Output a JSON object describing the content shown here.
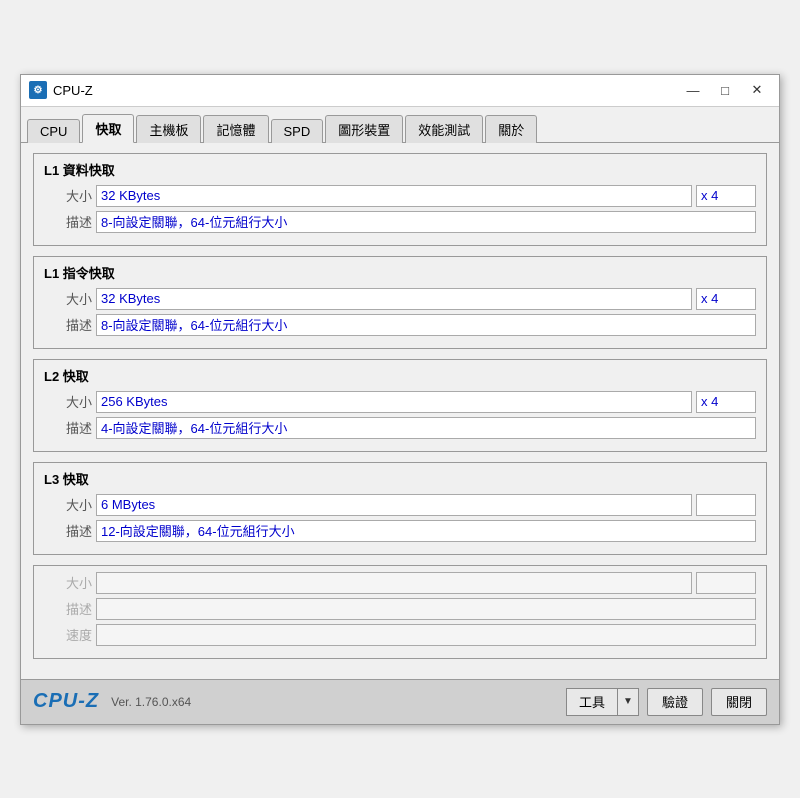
{
  "window": {
    "title": "CPU-Z",
    "icon_label": "⚙"
  },
  "title_controls": {
    "minimize": "—",
    "maximize": "□",
    "close": "✕"
  },
  "tabs": [
    {
      "id": "cpu",
      "label": "CPU",
      "active": false
    },
    {
      "id": "cache",
      "label": "快取",
      "active": true
    },
    {
      "id": "mainboard",
      "label": "主機板",
      "active": false
    },
    {
      "id": "memory",
      "label": "記憶體",
      "active": false
    },
    {
      "id": "spd",
      "label": "SPD",
      "active": false
    },
    {
      "id": "graphics",
      "label": "圖形裝置",
      "active": false
    },
    {
      "id": "benchmark",
      "label": "效能測試",
      "active": false
    },
    {
      "id": "about",
      "label": "關於",
      "active": false
    }
  ],
  "cache_sections": [
    {
      "id": "l1-data",
      "title": "L1 資料快取",
      "enabled": true,
      "size_value": "32 KBytes",
      "multiplier": "x 4",
      "desc_value": "8-向設定關聯，64-位元組行大小"
    },
    {
      "id": "l1-instruction",
      "title": "L1 指令快取",
      "enabled": true,
      "size_value": "32 KBytes",
      "multiplier": "x 4",
      "desc_value": "8-向設定關聯，64-位元組行大小"
    },
    {
      "id": "l2",
      "title": "L2 快取",
      "enabled": true,
      "size_value": "256 KBytes",
      "multiplier": "x 4",
      "desc_value": "4-向設定關聯，64-位元組行大小"
    },
    {
      "id": "l3",
      "title": "L3 快取",
      "enabled": true,
      "size_value": "6 MBytes",
      "multiplier": "",
      "desc_value": "12-向設定關聯，64-位元組行大小"
    }
  ],
  "disabled_section": {
    "label_size": "大小",
    "label_desc": "描述",
    "label_speed": "速度"
  },
  "footer": {
    "brand": "CPU-Z",
    "version": "Ver. 1.76.0.x64",
    "tools_label": "工具",
    "verify_label": "驗證",
    "close_label": "關閉"
  },
  "labels": {
    "size": "大小",
    "desc": "描述"
  }
}
